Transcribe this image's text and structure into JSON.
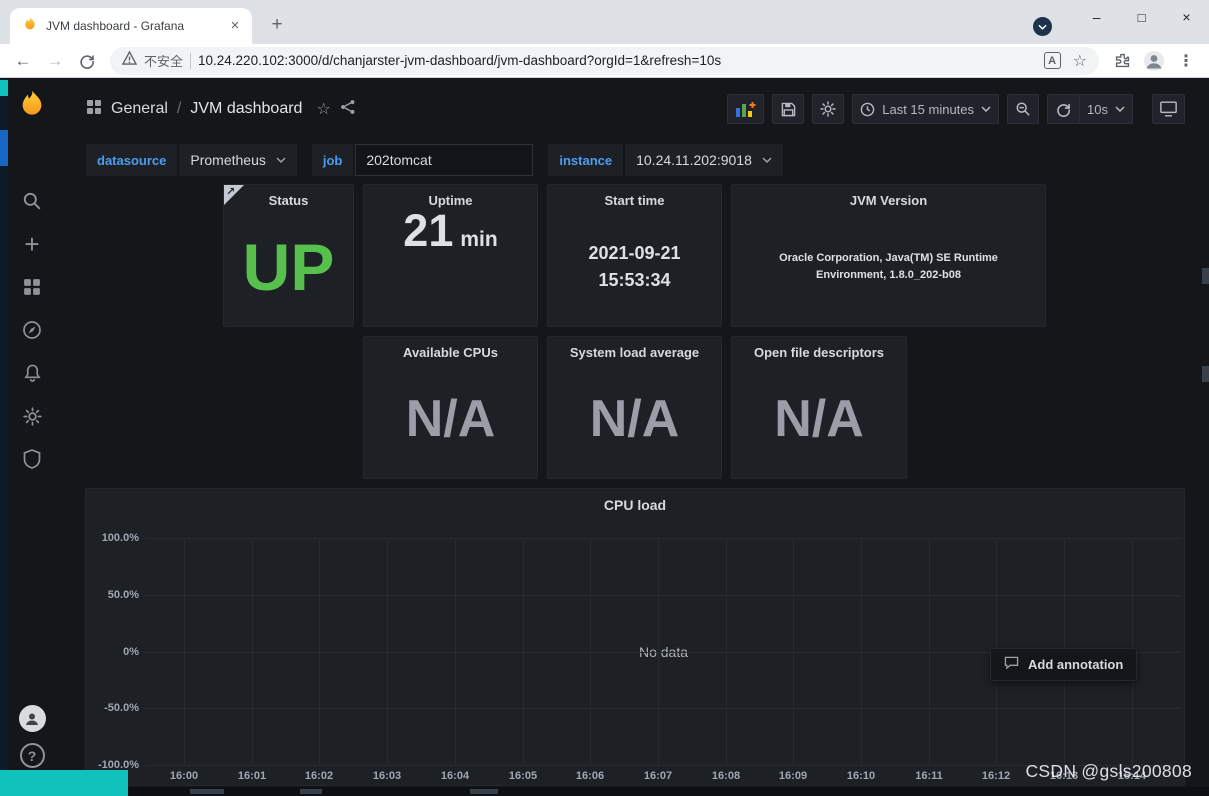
{
  "browser": {
    "tab": {
      "title": "JVM dashboard - Grafana"
    },
    "address": {
      "security_label": "不安全",
      "url": "10.24.220.102:3000/d/chanjarster-jvm-dashboard/jvm-dashboard?orgId=1&refresh=10s"
    }
  },
  "icons": {
    "tab_close": "×",
    "new_tab": "+",
    "minimize": "–",
    "maximize": "□",
    "close": "×",
    "back": "←",
    "forward": "→",
    "menu": "⋮",
    "bookmark_star": "☆",
    "title_star": "☆",
    "translate_glyph": "A",
    "breadcrumb_sep": "/",
    "panel_link_arrow": "↗",
    "sidebar_plus": "+",
    "help": "?"
  },
  "header": {
    "folder": "General",
    "title": "JVM dashboard",
    "time_range": "Last 15 minutes",
    "refresh_interval": "10s"
  },
  "variables": {
    "datasource_label": "datasource",
    "datasource_value": "Prometheus",
    "job_label": "job",
    "job_value": "202tomcat",
    "instance_label": "instance",
    "instance_value": "10.24.11.202:9018"
  },
  "stat_panels": [
    {
      "title": "Status",
      "value": "UP"
    },
    {
      "title": "Uptime",
      "value": "21",
      "unit": "min"
    },
    {
      "title": "Start time",
      "value": "2021-09-21",
      "value2": "15:53:34"
    },
    {
      "title": "JVM Version",
      "value": "Oracle Corporation, Java(TM) SE Runtime Environment, 1.8.0_202-b08"
    },
    {
      "title": "Available CPUs",
      "value": "N/A"
    },
    {
      "title": "System load average",
      "value": "N/A"
    },
    {
      "title": "Open file descriptors",
      "value": "N/A"
    }
  ],
  "chart_data": {
    "type": "line",
    "title": "CPU load",
    "no_data_text": "No data",
    "x_ticks": [
      "16:00",
      "16:01",
      "16:02",
      "16:03",
      "16:04",
      "16:05",
      "16:06",
      "16:07",
      "16:08",
      "16:09",
      "16:10",
      "16:11",
      "16:12",
      "16:13",
      "16:14"
    ],
    "y_ticks": [
      "100.0%",
      "50.0%",
      "0%",
      "-50.0%",
      "-100.0%"
    ],
    "ylim": [
      -100,
      100
    ],
    "series": [],
    "grid": true,
    "legend": false
  },
  "annotation_popup": {
    "label": "Add annotation"
  },
  "watermark": "CSDN @gsls200808",
  "colors": {
    "up_green": "#57c04d",
    "na_gray": "#9b9ea6",
    "accent_blue": "#4e9df0"
  }
}
